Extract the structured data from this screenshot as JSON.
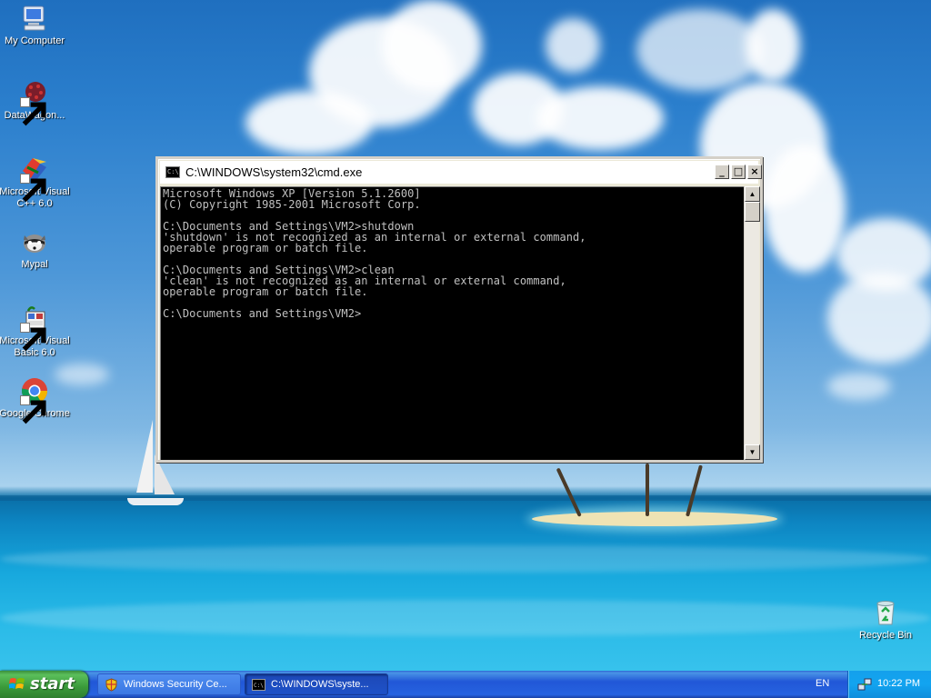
{
  "desktop": {
    "icons": [
      {
        "label": "My Computer",
        "icon": "my-computer-icon"
      },
      {
        "label": "DataWagon...",
        "icon": "datawagon-icon"
      },
      {
        "label": "Microsoft Visual C++ 6.0",
        "icon": "visual-cpp-icon"
      },
      {
        "label": "Mypal",
        "icon": "mypal-icon"
      },
      {
        "label": "Microsoft Visual Basic 6.0",
        "icon": "visual-basic-icon"
      },
      {
        "label": "Google Chrome",
        "icon": "chrome-icon"
      },
      {
        "label": "Recycle Bin",
        "icon": "recycle-bin-icon"
      }
    ]
  },
  "cmd_window": {
    "title": "C:\\WINDOWS\\system32\\cmd.exe",
    "buttons": {
      "minimize": "_",
      "maximize": "□",
      "close": "×"
    },
    "lines": [
      "Microsoft Windows XP [Version 5.1.2600]",
      "(C) Copyright 1985-2001 Microsoft Corp.",
      "",
      "C:\\Documents and Settings\\VM2>shutdown",
      "'shutdown' is not recognized as an internal or external command,",
      "operable program or batch file.",
      "",
      "C:\\Documents and Settings\\VM2>clean",
      "'clean' is not recognized as an internal or external command,",
      "operable program or batch file.",
      "",
      "C:\\Documents and Settings\\VM2>"
    ],
    "scrollbar": {
      "up": "▲",
      "down": "▼"
    }
  },
  "taskbar": {
    "start_label": "start",
    "tasks": [
      {
        "label": "Windows Security Ce...",
        "icon": "shield-icon",
        "active": false
      },
      {
        "label": "C:\\WINDOWS\\syste...",
        "icon": "cmd-icon",
        "active": true
      }
    ],
    "language": "EN",
    "clock": "10:22 PM"
  },
  "colors": {
    "console_bg": "#000000",
    "console_text": "#c0c0c0",
    "taskbar_blue": "#245edb",
    "start_green": "#3a9a3a"
  }
}
